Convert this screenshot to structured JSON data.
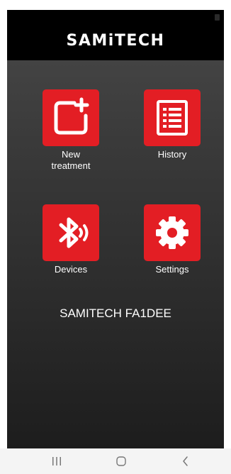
{
  "header": {
    "logo_text": "SAMiTECH"
  },
  "menu": {
    "new_treatment": {
      "label_line1": "New",
      "label_line2": "treatment",
      "icon": "new-treatment-icon"
    },
    "history": {
      "label": "History",
      "icon": "list-icon"
    },
    "devices": {
      "label": "Devices",
      "icon": "bluetooth-icon"
    },
    "settings": {
      "label": "Settings",
      "icon": "gear-icon"
    }
  },
  "device": {
    "name": "SAMITECH FA1DEE"
  },
  "navbar": {
    "recents_icon": "recents-icon",
    "home_icon": "home-icon",
    "back_icon": "back-icon"
  },
  "colors": {
    "accent": "#e31e24",
    "header_bg": "#000000",
    "text": "#ffffff"
  }
}
